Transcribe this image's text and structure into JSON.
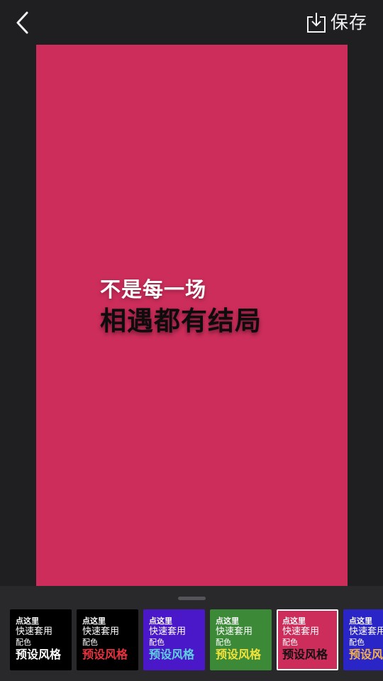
{
  "header": {
    "save_label": "保存",
    "back_icon": "chevron-left-icon",
    "save_icon": "download-icon"
  },
  "canvas": {
    "background": "#cd2d5b",
    "line1": "不是每一场",
    "line2": "相遇都有结局"
  },
  "style_cards": [
    {
      "l1": "点这里",
      "l2": "快速套用",
      "l3": "配色",
      "l4": "预设风格",
      "bg": "#000000",
      "accent": "#ffffff",
      "selected": false
    },
    {
      "l1": "点这里",
      "l2": "快速套用",
      "l3": "配色",
      "l4": "预设风格",
      "bg": "#000000",
      "accent": "#e8333f",
      "selected": false
    },
    {
      "l1": "点这里",
      "l2": "快速套用",
      "l3": "配色",
      "l4": "预设风格",
      "bg": "#4a18c9",
      "accent": "#5fd2e0",
      "selected": false
    },
    {
      "l1": "点这里",
      "l2": "快速套用",
      "l3": "配色",
      "l4": "预设风格",
      "bg": "#3c8a38",
      "accent": "#f3e23a",
      "selected": false
    },
    {
      "l1": "点这里",
      "l2": "快速套用",
      "l3": "配色",
      "l4": "预设风格",
      "bg": "#cd2d5b",
      "accent": "#111111",
      "selected": true
    },
    {
      "l1": "点这里",
      "l2": "快速套用",
      "l3": "配色",
      "l4": "预设风格",
      "bg": "#2a25c7",
      "accent": "#f4b24a",
      "selected": false
    }
  ]
}
